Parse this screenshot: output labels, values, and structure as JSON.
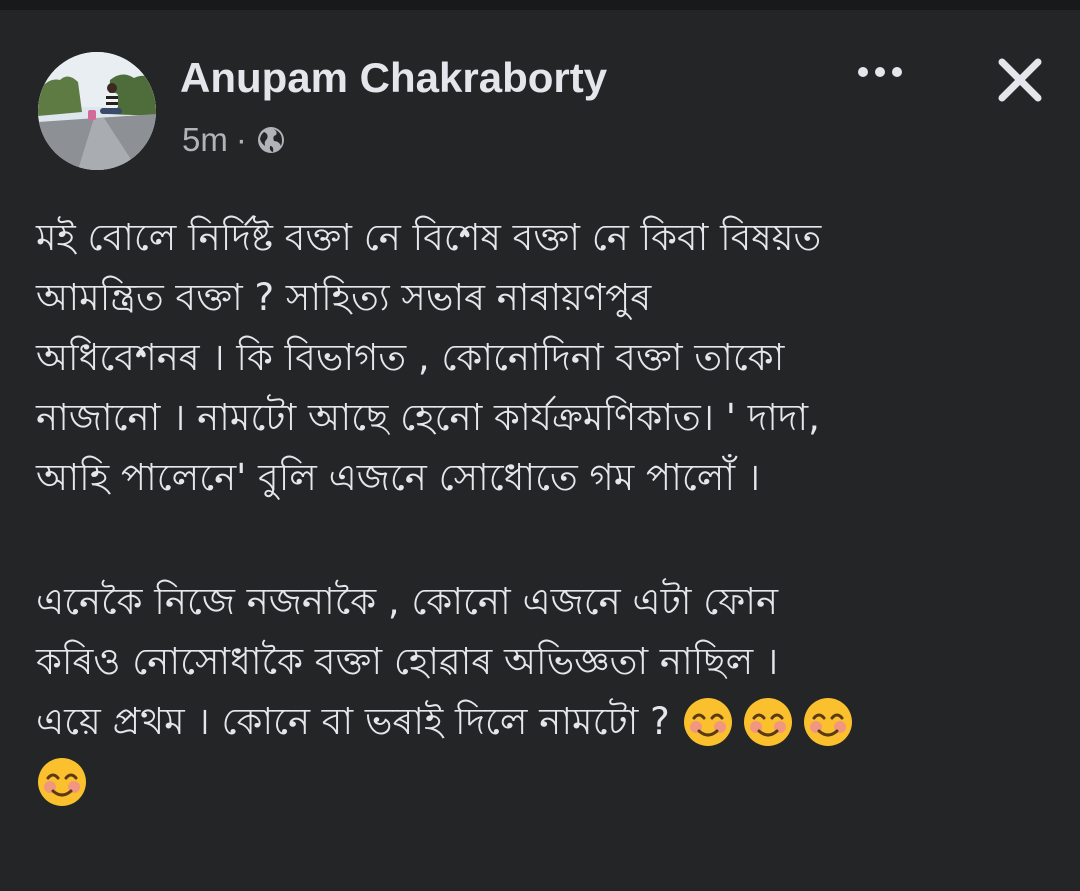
{
  "post": {
    "author": "Anupam Chakraborty",
    "time": "5m",
    "separator": "·",
    "privacy_icon": "globe-icon",
    "more_icon": "more-dots-icon",
    "close_icon": "close-icon",
    "paragraph1": [
      "মই বোলে নিৰ্দিষ্ট বক্তা নে বিশেষ বক্তা নে কিবা বিষয়ত",
      "আমন্ত্ৰিত বক্তা  ? সাহিত্য সভাৰ নাৰায়ণপুৰ",
      "অধিবেশনৰ । কি বিভাগত , কোনোদিনা বক্তা তাকো",
      "নাজানো । নামটো আছে হেনো কাৰ্যক্ৰমণিকাত। ' দাদা,",
      "আহি পালেনে'  বুলি এজনে সোধোতে গম পালোঁ ।"
    ],
    "paragraph2": [
      "এনেকৈ নিজে নজনাকৈ , কোনো এজনে এটা ফোন",
      "কৰিও নোসোধাকৈ বক্তা হোৱাৰ  অভিজ্ঞতা নাছিল ।",
      "এয়ে প্ৰথম । কোনে বা ভৰাই দিলে নামটো ?"
    ],
    "emoji_icon": "smiling-blush-emoji-icon"
  },
  "colors": {
    "background": "#242526",
    "text": "#e4e6eb",
    "meta": "#b0b3b8",
    "emoji_face": "#fbc02d"
  }
}
